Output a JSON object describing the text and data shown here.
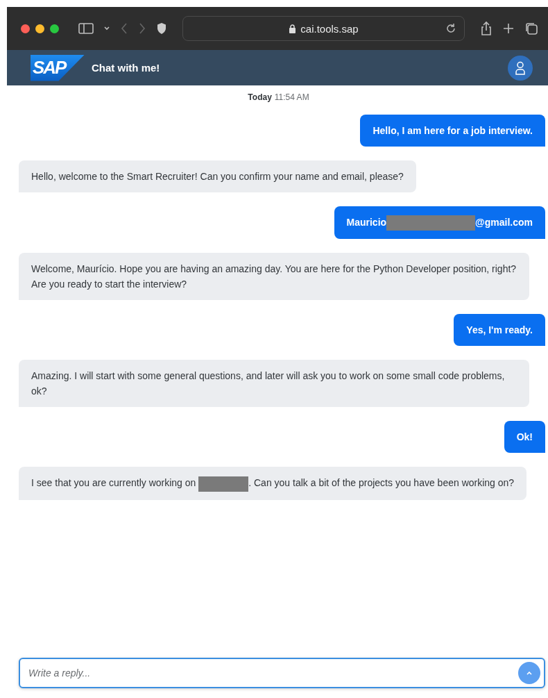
{
  "browser": {
    "url": "cai.tools.sap"
  },
  "header": {
    "logo": "SAP",
    "title": "Chat with me!"
  },
  "timestamp": {
    "day": "Today",
    "time": "11:54 AM"
  },
  "messages": [
    {
      "kind": "user",
      "parts": [
        {
          "kind": "text",
          "text": "Hello, I am here for a job interview."
        }
      ]
    },
    {
      "kind": "bot",
      "parts": [
        {
          "kind": "text",
          "text": "Hello, welcome to the Smart Recruiter! Can you confirm your name and email, please?"
        }
      ]
    },
    {
      "kind": "user",
      "parts": [
        {
          "kind": "text",
          "text": "Mauricio"
        },
        {
          "kind": "redacted"
        },
        {
          "kind": "text",
          "text": "@gmail.com"
        }
      ]
    },
    {
      "kind": "bot",
      "parts": [
        {
          "kind": "text",
          "text": "Welcome, Maurício. Hope you are having an amazing day. You are here for the Python Developer position, right? Are you ready to start the interview?"
        }
      ]
    },
    {
      "kind": "user",
      "parts": [
        {
          "kind": "text",
          "text": "Yes, I'm ready."
        }
      ]
    },
    {
      "kind": "bot",
      "parts": [
        {
          "kind": "text",
          "text": "Amazing. I will start with some general questions, and later will ask you to work on some small code problems, ok?"
        }
      ]
    },
    {
      "kind": "user",
      "parts": [
        {
          "kind": "text",
          "text": "Ok!"
        }
      ]
    },
    {
      "kind": "bot",
      "parts": [
        {
          "kind": "text",
          "text": "I see that you are currently working on "
        },
        {
          "kind": "redacted"
        },
        {
          "kind": "text",
          "text": ". Can you talk a bit of the projects you have been working on?"
        }
      ]
    }
  ],
  "composer": {
    "placeholder": "Write a reply..."
  }
}
